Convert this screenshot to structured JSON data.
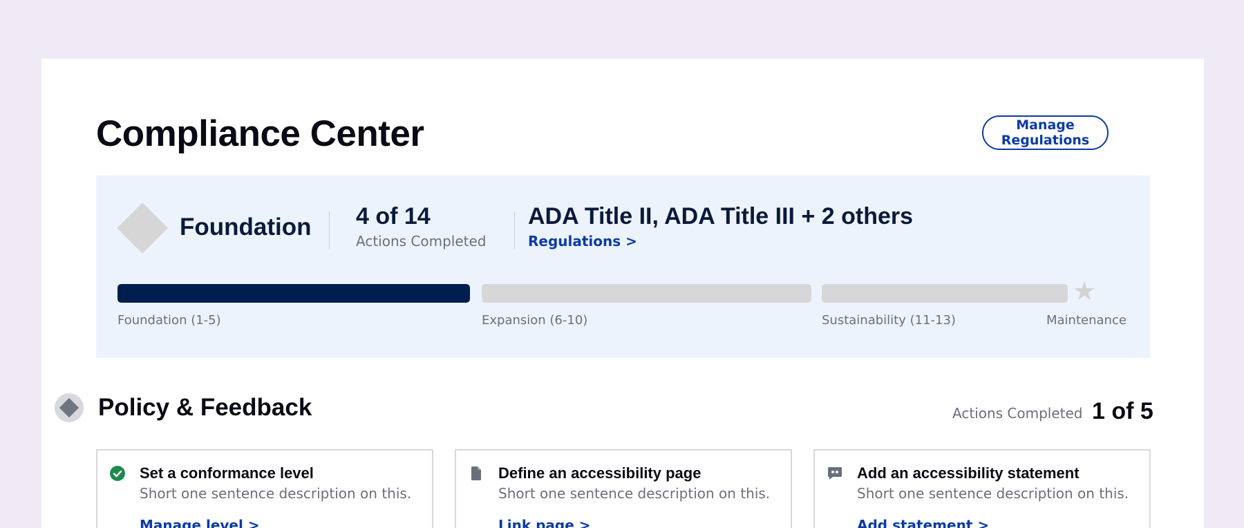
{
  "header": {
    "title": "Compliance Center",
    "manage_label": "Manage Regulations"
  },
  "summary": {
    "level_name": "Foundation",
    "actions_count": "4 of 14",
    "actions_label": "Actions Completed",
    "regulations_title": "ADA Title II, ADA Title III + 2 others",
    "regulations_link": "Regulations >",
    "progress": [
      {
        "label": "Foundation (1-5)",
        "fill_fraction": 1.0
      },
      {
        "label": "Expansion (6-10)",
        "fill_fraction": 0.0
      },
      {
        "label": "Sustainability (11-13)",
        "fill_fraction": 0.0
      }
    ],
    "final_stage_label": "Maintenance",
    "colors": {
      "progress_fill": "#001e4d",
      "progress_track": "#d7d7d9",
      "panel_background": "#edf3fd"
    }
  },
  "section": {
    "title": "Policy & Feedback",
    "count_label": "Actions Completed",
    "count": "1 of 5",
    "actions": [
      {
        "icon": "check-circle-icon",
        "title": "Set a conformance level",
        "description": "Short one sentence description on this.",
        "link": "Manage level >",
        "completed": true
      },
      {
        "icon": "document-icon",
        "title": "Define an accessibility page",
        "description": "Short one sentence description on this.",
        "link": "Link page >",
        "completed": false
      },
      {
        "icon": "quote-bubble-icon",
        "title": "Add an accessibility statement",
        "description": "Short one sentence description on this.",
        "link": "Add statement >",
        "completed": false
      }
    ]
  },
  "colors": {
    "accent": "#0b3aa8",
    "success": "#1f8a4c",
    "page_background": "#f0eaf6"
  }
}
